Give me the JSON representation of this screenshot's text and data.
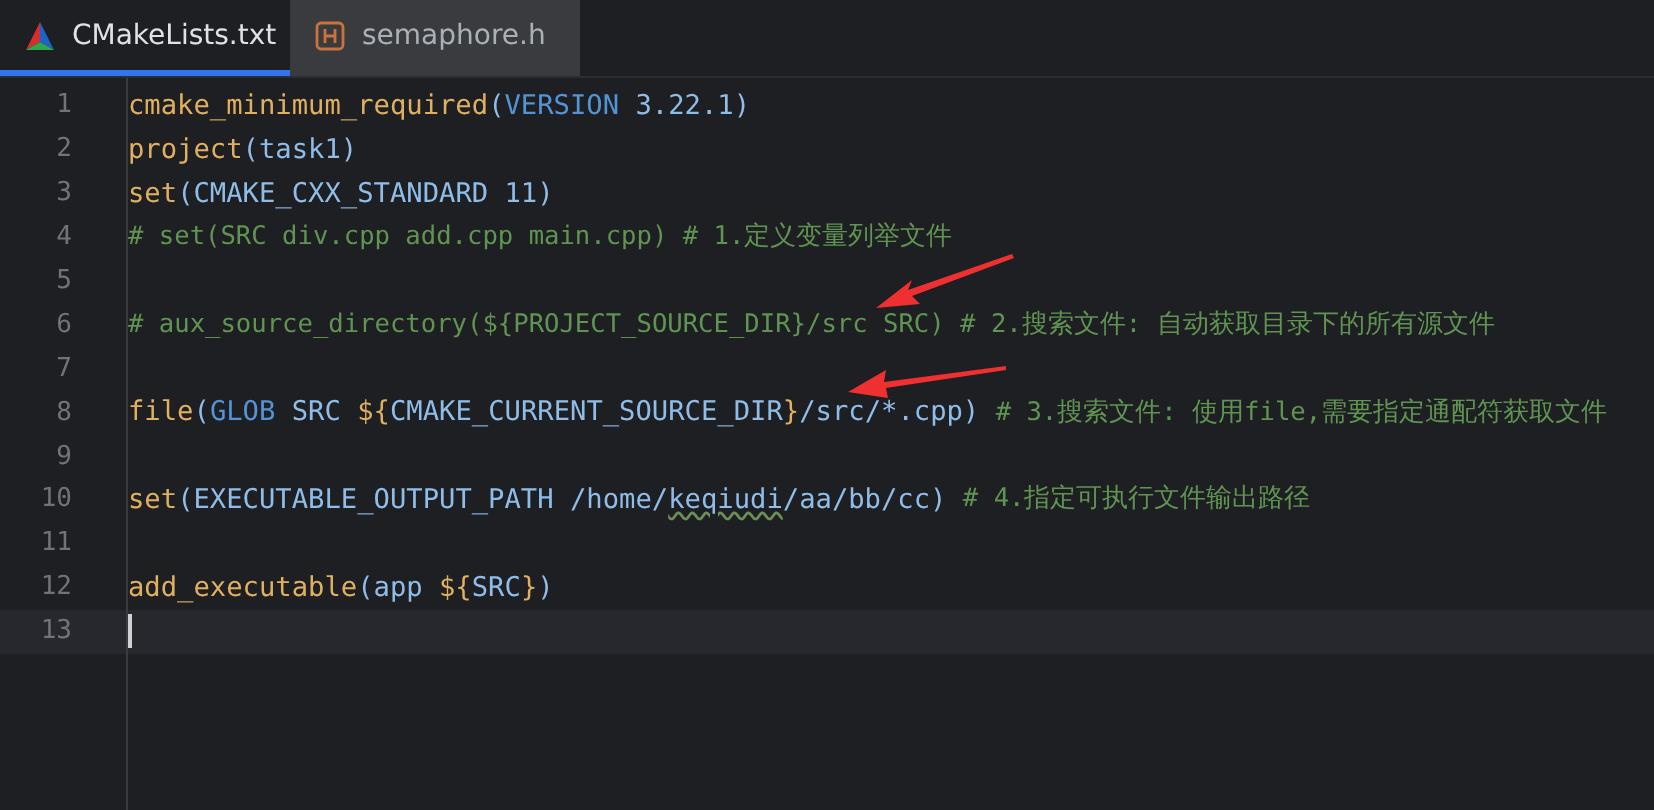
{
  "tabs": [
    {
      "label": "CMakeLists.txt",
      "kind": "cmake",
      "selected": true
    },
    {
      "label": "semaphore.h",
      "kind": "header",
      "selected": false
    }
  ],
  "editor": {
    "lines": [
      {
        "number": "1",
        "tokens": [
          {
            "kind": "fn",
            "text": "cmake_minimum_required"
          },
          {
            "kind": "plain",
            "text": "("
          },
          {
            "kind": "kw",
            "text": "VERSION"
          },
          {
            "kind": "plain",
            "text": " 3.22.1)"
          }
        ]
      },
      {
        "number": "2",
        "tokens": [
          {
            "kind": "fn",
            "text": "project"
          },
          {
            "kind": "plain",
            "text": "(task1)"
          }
        ]
      },
      {
        "number": "3",
        "tokens": [
          {
            "kind": "fn",
            "text": "set"
          },
          {
            "kind": "plain",
            "text": "(CMAKE_CXX_STANDARD 11)"
          }
        ]
      },
      {
        "number": "4",
        "tokens": [
          {
            "kind": "comment",
            "text": "# set(SRC div.cpp add.cpp main.cpp) # 1.定义变量列举文件"
          }
        ]
      },
      {
        "number": "5"
      },
      {
        "number": "6",
        "tokens": [
          {
            "kind": "comment",
            "text": "# aux_source_directory(${PROJECT_SOURCE_DIR}/src SRC) # 2.搜索文件: 自动获取目录下的所有源文件"
          }
        ]
      },
      {
        "number": "7"
      },
      {
        "number": "8",
        "tokens": [
          {
            "kind": "fn",
            "text": "file"
          },
          {
            "kind": "plain",
            "text": "("
          },
          {
            "kind": "kw",
            "text": "GLOB"
          },
          {
            "kind": "plain",
            "text": " SRC "
          },
          {
            "kind": "var",
            "text": "${"
          },
          {
            "kind": "plain",
            "text": "CMAKE_CURRENT_SOURCE_DIR"
          },
          {
            "kind": "var",
            "text": "}"
          },
          {
            "kind": "plain",
            "text": "/src/*.cpp) "
          },
          {
            "kind": "comment",
            "text": "# 3.搜索文件: 使用file,需要指定通配符获取文件"
          }
        ]
      },
      {
        "number": "9"
      },
      {
        "number": "10",
        "tokens": [
          {
            "kind": "fn",
            "text": "set"
          },
          {
            "kind": "plain",
            "text": "(EXECUTABLE_OUTPUT_PATH /home/"
          },
          {
            "kind": "typo",
            "text": "keqiudi"
          },
          {
            "kind": "plain",
            "text": "/aa/bb/cc) "
          },
          {
            "kind": "comment",
            "text": "# 4.指定可执行文件输出路径"
          }
        ]
      },
      {
        "number": "11"
      },
      {
        "number": "12",
        "tokens": [
          {
            "kind": "fn",
            "text": "add_executable"
          },
          {
            "kind": "plain",
            "text": "(app "
          },
          {
            "kind": "var",
            "text": "${"
          },
          {
            "kind": "plain",
            "text": "SRC"
          },
          {
            "kind": "var",
            "text": "}"
          },
          {
            "kind": "plain",
            "text": ")"
          }
        ]
      },
      {
        "number": "13",
        "current": true
      }
    ]
  }
}
